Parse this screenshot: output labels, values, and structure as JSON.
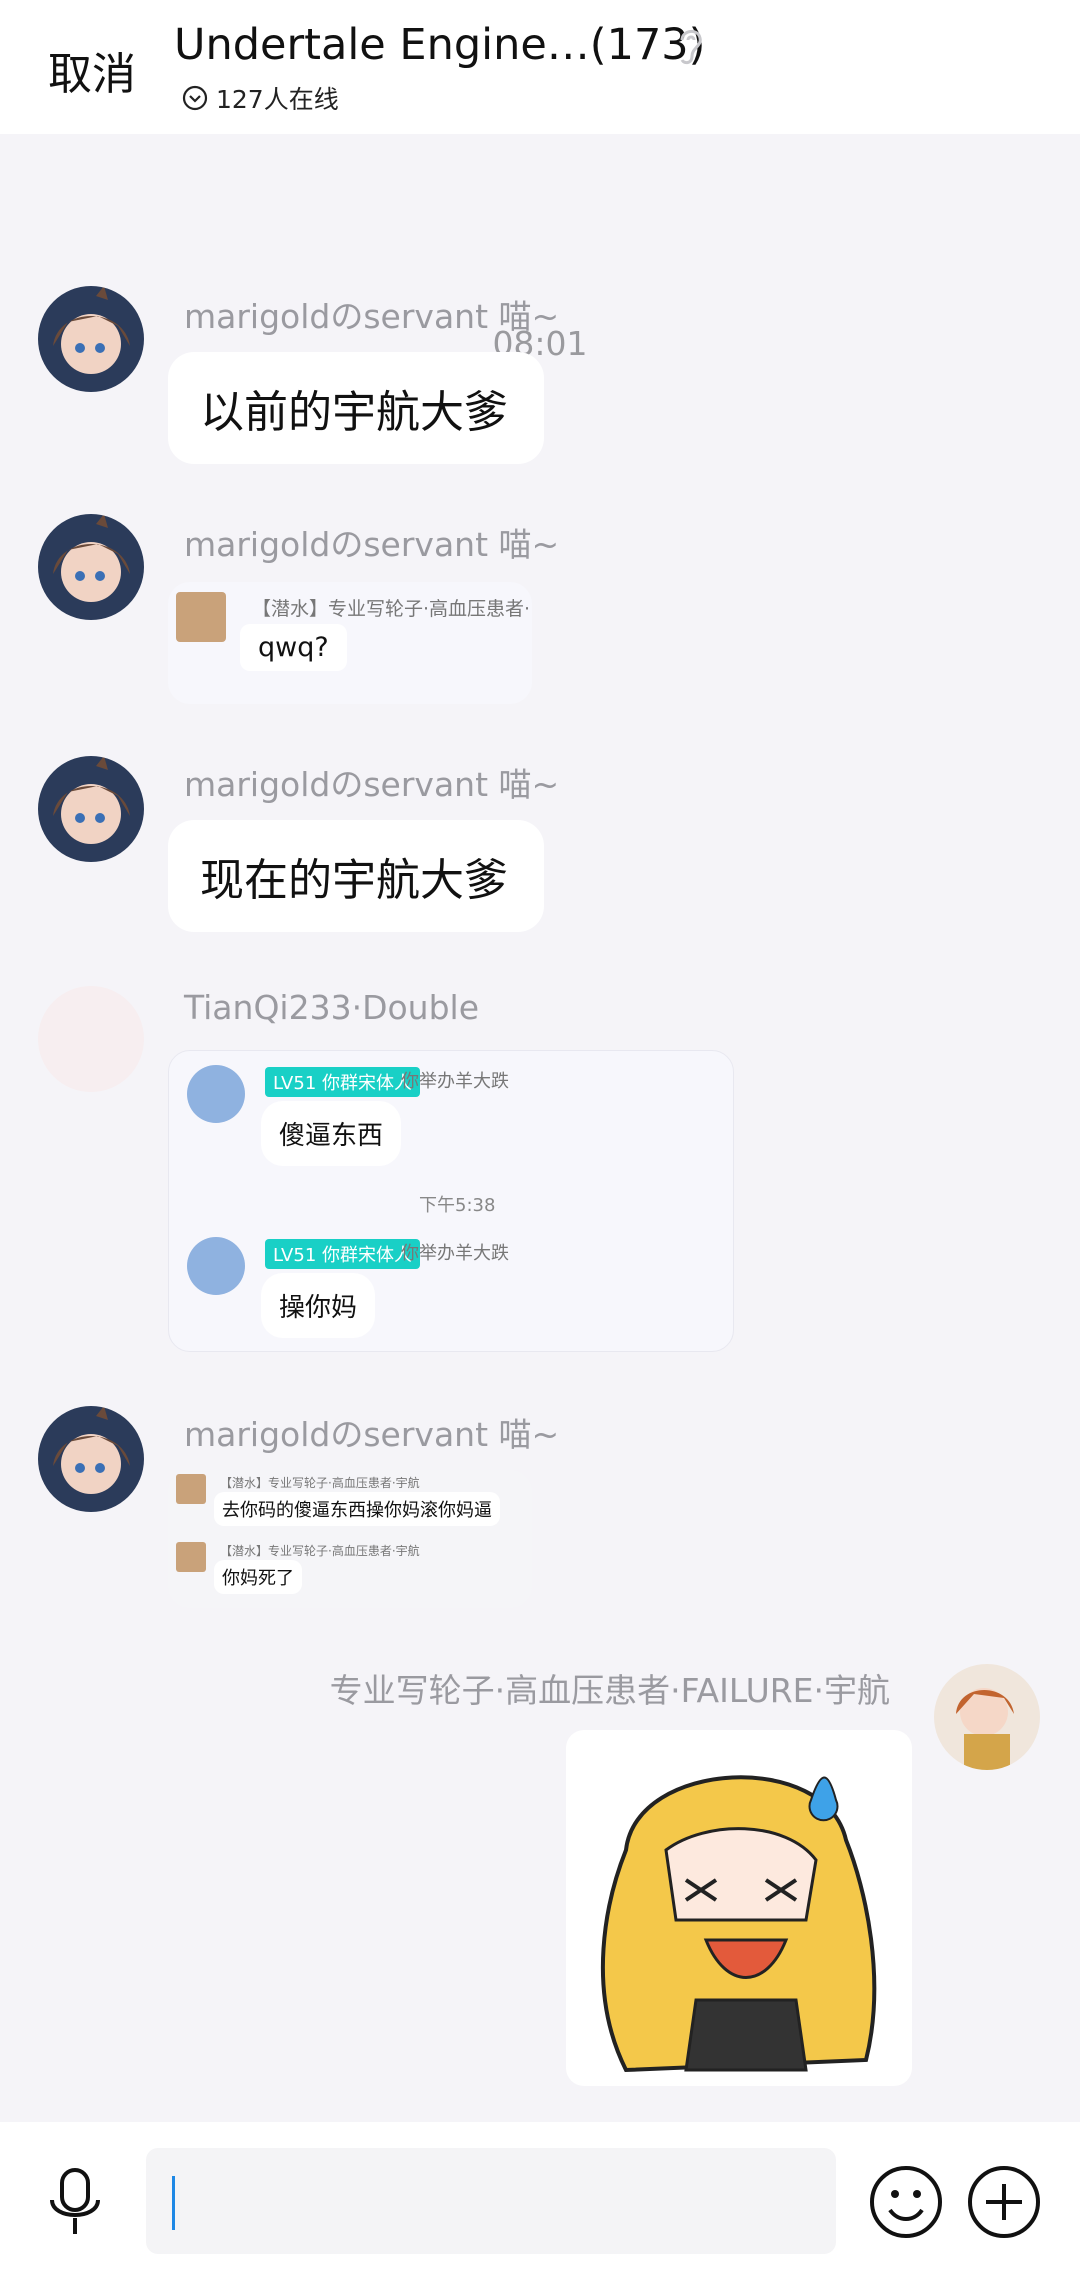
{
  "header": {
    "cancel_label": "取消",
    "title": "Undertale Engine…(173)",
    "online": "127人在线"
  },
  "chat": {
    "time": "08:01",
    "messages": [
      {
        "sender": "marigoldのservant 喵~",
        "text": "以前的宇航大爹"
      },
      {
        "sender": "marigoldのservant 喵~",
        "quote_name": "【潜水】专业写轮子·高血压患者·",
        "quote_text": "qwq?"
      },
      {
        "sender": "marigoldのservant 喵~",
        "text": "现在的宇航大爹"
      },
      {
        "sender": "TianQi233·Double",
        "card": {
          "tag": "LV51 你群宋体人",
          "title_suffix": "你举办羊大跌",
          "msg1": "傻逼东西",
          "time": "下午5:38",
          "msg2": "操你妈"
        }
      },
      {
        "sender": "marigoldのservant 喵~",
        "forward": {
          "name1": "【潜水】专业写轮子·高血压患者·宇航",
          "msg1": "去你码的傻逼东西操你妈滚你妈逼",
          "name2": "【潜水】专业写轮子·高血压患者·宇航",
          "msg2": "你妈死了"
        }
      },
      {
        "sender": "专业写轮子·高血压患者·FAILURE·宇航",
        "image": "sticker-image"
      }
    ]
  },
  "icons": {
    "mic": "microphone-icon",
    "emoji": "emoji-icon",
    "plus": "plus-icon",
    "ear": "ear-icon",
    "chevron": "chevron-down-icon"
  }
}
